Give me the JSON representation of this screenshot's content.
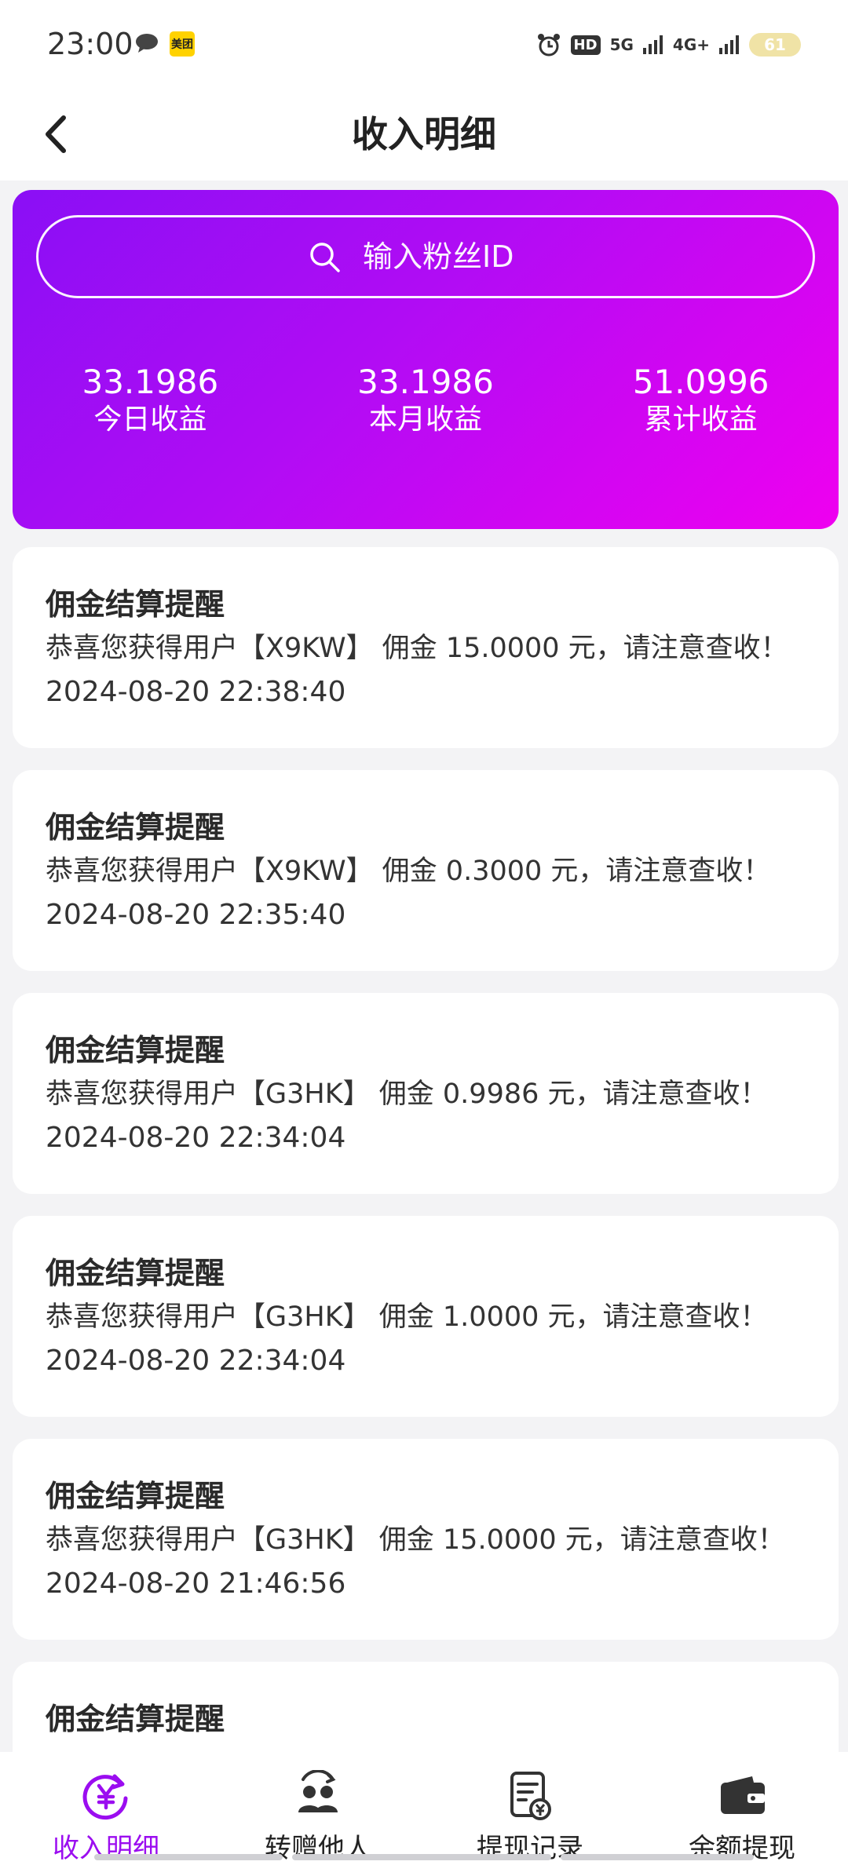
{
  "status_bar": {
    "time": "23:00",
    "meituan_label": "美团",
    "hd_label": "HD",
    "net1_label": "5G",
    "net2_label": "4G+",
    "battery": "61"
  },
  "header": {
    "title": "收入明细",
    "back_icon": "chevron-left-icon"
  },
  "summary": {
    "search_placeholder": "输入粉丝ID",
    "stats": [
      {
        "value": "33.1986",
        "label": "今日收益"
      },
      {
        "value": "33.1986",
        "label": "本月收益"
      },
      {
        "value": "51.0996",
        "label": "累计收益"
      }
    ],
    "gradient_start": "#8a0ff5",
    "gradient_end": "#ef00f0"
  },
  "records": [
    {
      "title": "佣金结算提醒",
      "message": "恭喜您获得用户【X9KW】 佣金 15.0000 元，请注意查收！",
      "time": "2024-08-20 22:38:40"
    },
    {
      "title": "佣金结算提醒",
      "message": "恭喜您获得用户【X9KW】 佣金 0.3000 元，请注意查收！",
      "time": "2024-08-20 22:35:40"
    },
    {
      "title": "佣金结算提醒",
      "message": "恭喜您获得用户【G3HK】 佣金 0.9986 元，请注意查收！",
      "time": "2024-08-20 22:34:04"
    },
    {
      "title": "佣金结算提醒",
      "message": "恭喜您获得用户【G3HK】 佣金 1.0000 元，请注意查收！",
      "time": "2024-08-20 22:34:04"
    },
    {
      "title": "佣金结算提醒",
      "message": "恭喜您获得用户【G3HK】 佣金 15.0000 元，请注意查收！",
      "time": "2024-08-20 21:46:56"
    },
    {
      "title": "佣金结算提醒",
      "message": "",
      "time": ""
    }
  ],
  "bottom_nav": [
    {
      "label": "收入明细",
      "icon": "yuan-refresh-icon",
      "active": true
    },
    {
      "label": "转赠他人",
      "icon": "users-transfer-icon",
      "active": false
    },
    {
      "label": "提现记录",
      "icon": "document-yuan-icon",
      "active": false
    },
    {
      "label": "余额提现",
      "icon": "wallet-icon",
      "active": false
    }
  ],
  "accent_color": "#9b0df0"
}
